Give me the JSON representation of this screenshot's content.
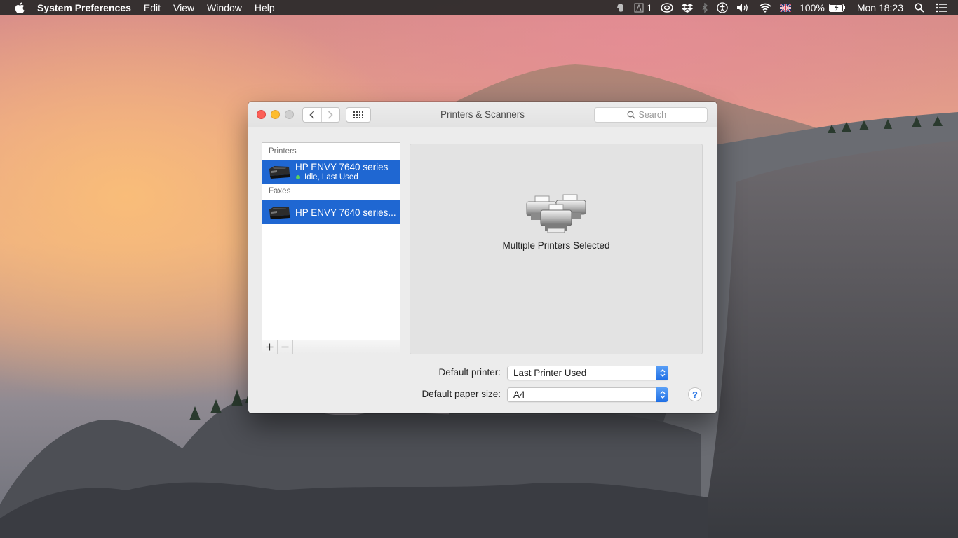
{
  "menubar": {
    "app_name": "System Preferences",
    "menus": [
      "Edit",
      "View",
      "Window",
      "Help"
    ],
    "status": {
      "text_count": "1",
      "battery": "100%",
      "clock": "Mon 18:23"
    }
  },
  "window": {
    "title": "Printers & Scanners",
    "search_placeholder": "Search"
  },
  "printer_list": {
    "printers_header": "Printers",
    "printer": {
      "name": "HP ENVY 7640 series",
      "status": "Idle, Last Used",
      "status_color": "#5ad25a"
    },
    "faxes_header": "Faxes",
    "fax": {
      "name": "HP ENVY 7640 series..."
    },
    "add_icon": "plus-icon",
    "remove_icon": "minus-icon"
  },
  "detail": {
    "label": "Multiple Printers Selected"
  },
  "defaults": {
    "printer_label": "Default printer:",
    "printer_value": "Last Printer Used",
    "paper_label": "Default paper size:",
    "paper_value": "A4"
  },
  "help": "?",
  "colors": {
    "selection": "#1f67d2",
    "close": "#fc5f57",
    "minimize": "#fdbc2e",
    "stepper": "#1f6fe5"
  }
}
